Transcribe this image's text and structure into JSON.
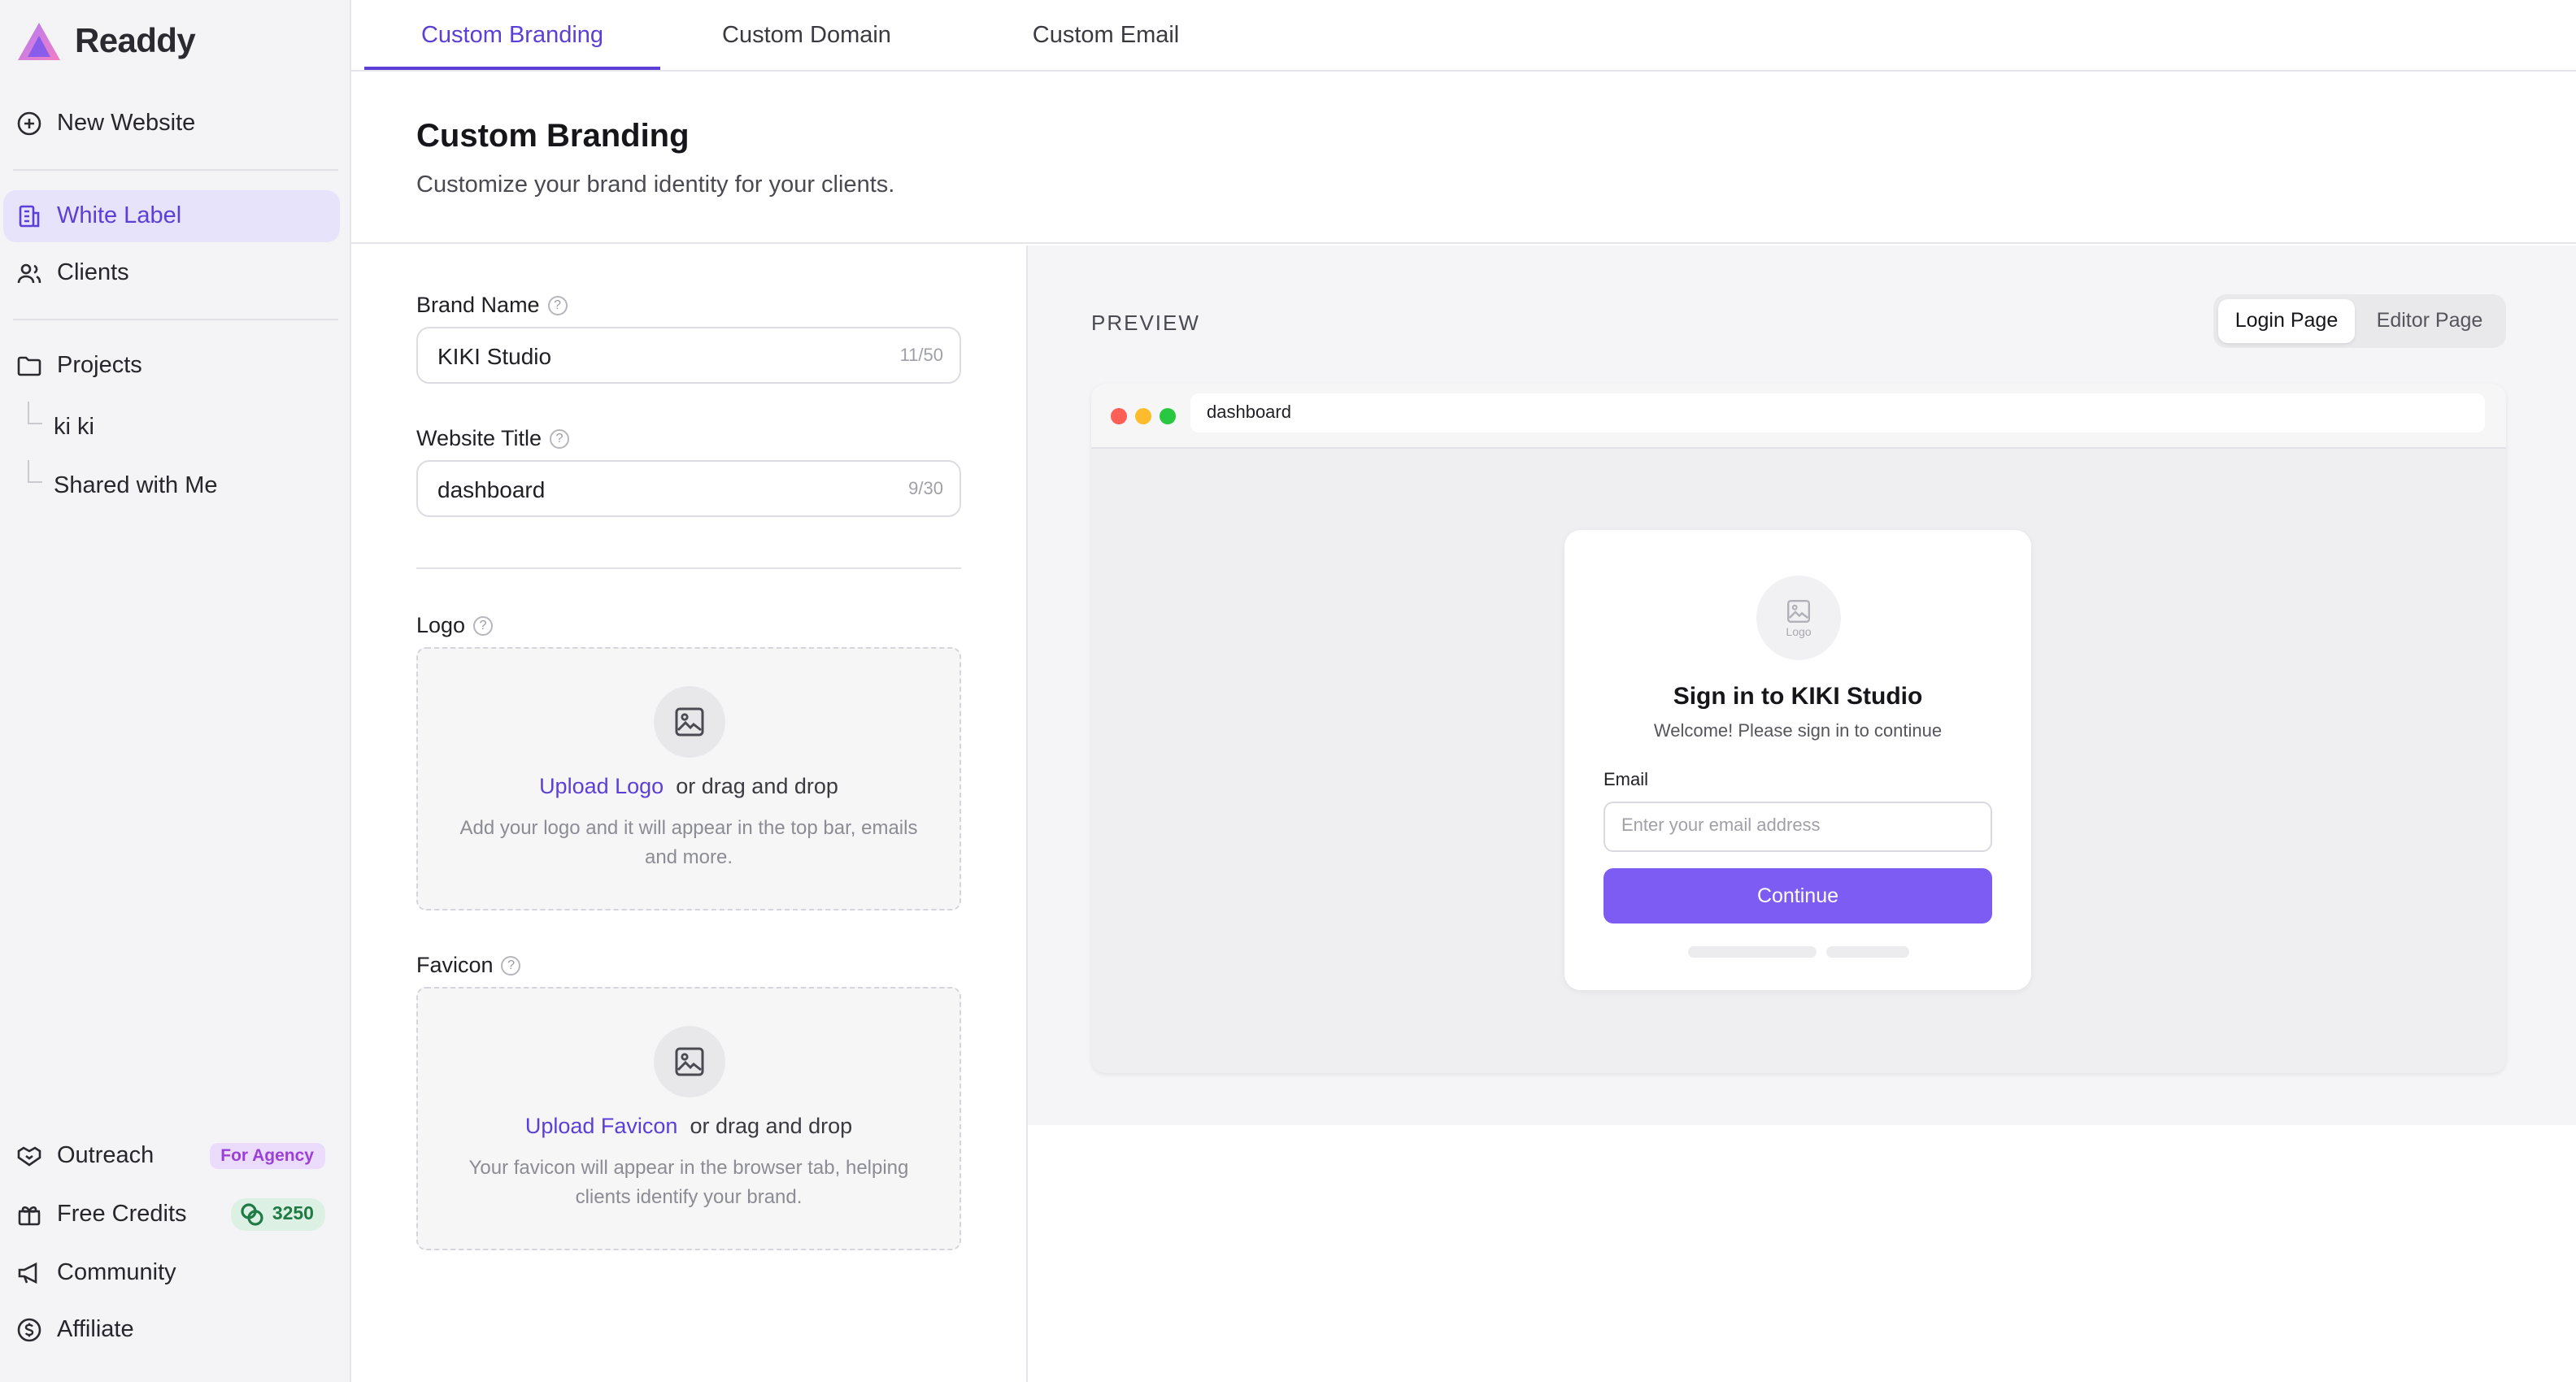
{
  "brand": {
    "name": "Readdy"
  },
  "sidebar": {
    "new_website": "New Website",
    "white_label": "White Label",
    "clients": "Clients",
    "projects": "Projects",
    "project_items": [
      "ki ki",
      "Shared with Me"
    ],
    "outreach": "Outreach",
    "outreach_badge": "For Agency",
    "free_credits": "Free Credits",
    "credits_count": "3250",
    "community": "Community",
    "affiliate": "Affiliate"
  },
  "tabs": [
    "Custom Branding",
    "Custom Domain",
    "Custom Email"
  ],
  "header": {
    "title": "Custom Branding",
    "subtitle": "Customize your brand identity for your clients."
  },
  "form": {
    "brand_name_label": "Brand Name",
    "brand_name_value": "KIKI Studio",
    "brand_name_count": "11/50",
    "website_title_label": "Website Title",
    "website_title_value": "dashboard",
    "website_title_count": "9/30",
    "logo_label": "Logo",
    "logo_upload_link": "Upload Logo",
    "logo_drag_text": "or drag and drop",
    "logo_hint": "Add your logo and it will appear in the top bar, emails and more.",
    "favicon_label": "Favicon",
    "favicon_upload_link": "Upload Favicon",
    "favicon_drag_text": "or drag and drop",
    "favicon_hint": "Your favicon will appear in the browser tab, helping clients identify your brand."
  },
  "preview": {
    "label": "PREVIEW",
    "segments": [
      "Login Page",
      "Editor Page"
    ],
    "url": "dashboard",
    "card": {
      "logo_placeholder": "Logo",
      "title": "Sign in to KIKI Studio",
      "subtitle": "Welcome! Please sign in to continue",
      "email_label": "Email",
      "email_placeholder": "Enter your email address",
      "button": "Continue"
    }
  },
  "colors": {
    "accent": "#5b3fd6",
    "button": "#7c5cf2",
    "traffic_red": "#fd5f57",
    "traffic_yellow": "#fdbc2e",
    "traffic_green": "#28c840"
  }
}
